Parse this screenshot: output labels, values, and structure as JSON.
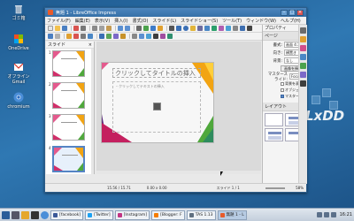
{
  "desktop": {
    "icons": [
      {
        "label": "ゴミ箱",
        "icon": "trash-icon"
      },
      {
        "label": "OneDrive",
        "icon": "cloud-icon"
      },
      {
        "label": "オフライン\nGmail",
        "icon": "gmail-icon"
      },
      {
        "label": "chromium",
        "icon": "chromium-icon"
      }
    ],
    "brand": "LxDD"
  },
  "window": {
    "title": "無題 1 - LibreOffice Impress",
    "menu": [
      "ファイル(F)",
      "編集(E)",
      "表示(V)",
      "挿入(I)",
      "書式(O)",
      "スライド(L)",
      "スライドショー(S)",
      "ツール(T)",
      "ウィンドウ(W)",
      "ヘルプ(H)"
    ],
    "slides_pane": {
      "title": "スライド",
      "count": 4,
      "selected": 4
    },
    "slide": {
      "title_placeholder": "クリックしてタイトルの挿入",
      "body_placeholder": "・クリックしてテキストの挿入"
    },
    "sidebar": {
      "title": "プロパティ",
      "section_page": "ページ",
      "format_label": "書式:",
      "format_value": "画面 4:3",
      "orientation_label": "向き:",
      "orientation_value": "横置き",
      "background_label": "背景:",
      "background_value": "なし",
      "background_image_button": "画像を挿入",
      "master_label": "マスタースライド:",
      "master_value": "Focus",
      "check_background": "背景を表示",
      "check_objects": "オブジェクト",
      "master_button": "マスター",
      "section_layout": "レイアウト"
    },
    "status": {
      "position": "15.56 / 15.71",
      "size": "0.00 x 0.00",
      "slide_of": "スライド 1 / 1",
      "zoom": "58%"
    }
  },
  "taskbar": {
    "buttons": [
      {
        "label": "[facebook]",
        "color": "#3b5998"
      },
      {
        "label": "[Twitter]",
        "color": "#1da1f2"
      },
      {
        "label": "[Instagram]",
        "color": "#c13584"
      },
      {
        "label": "[Blogger: F",
        "color": "#f57d00"
      },
      {
        "label": "TAS 1.13",
        "color": "#607080"
      },
      {
        "label": "無題 1 - L",
        "color": "#e85b2b"
      }
    ],
    "clock": "16:21"
  }
}
